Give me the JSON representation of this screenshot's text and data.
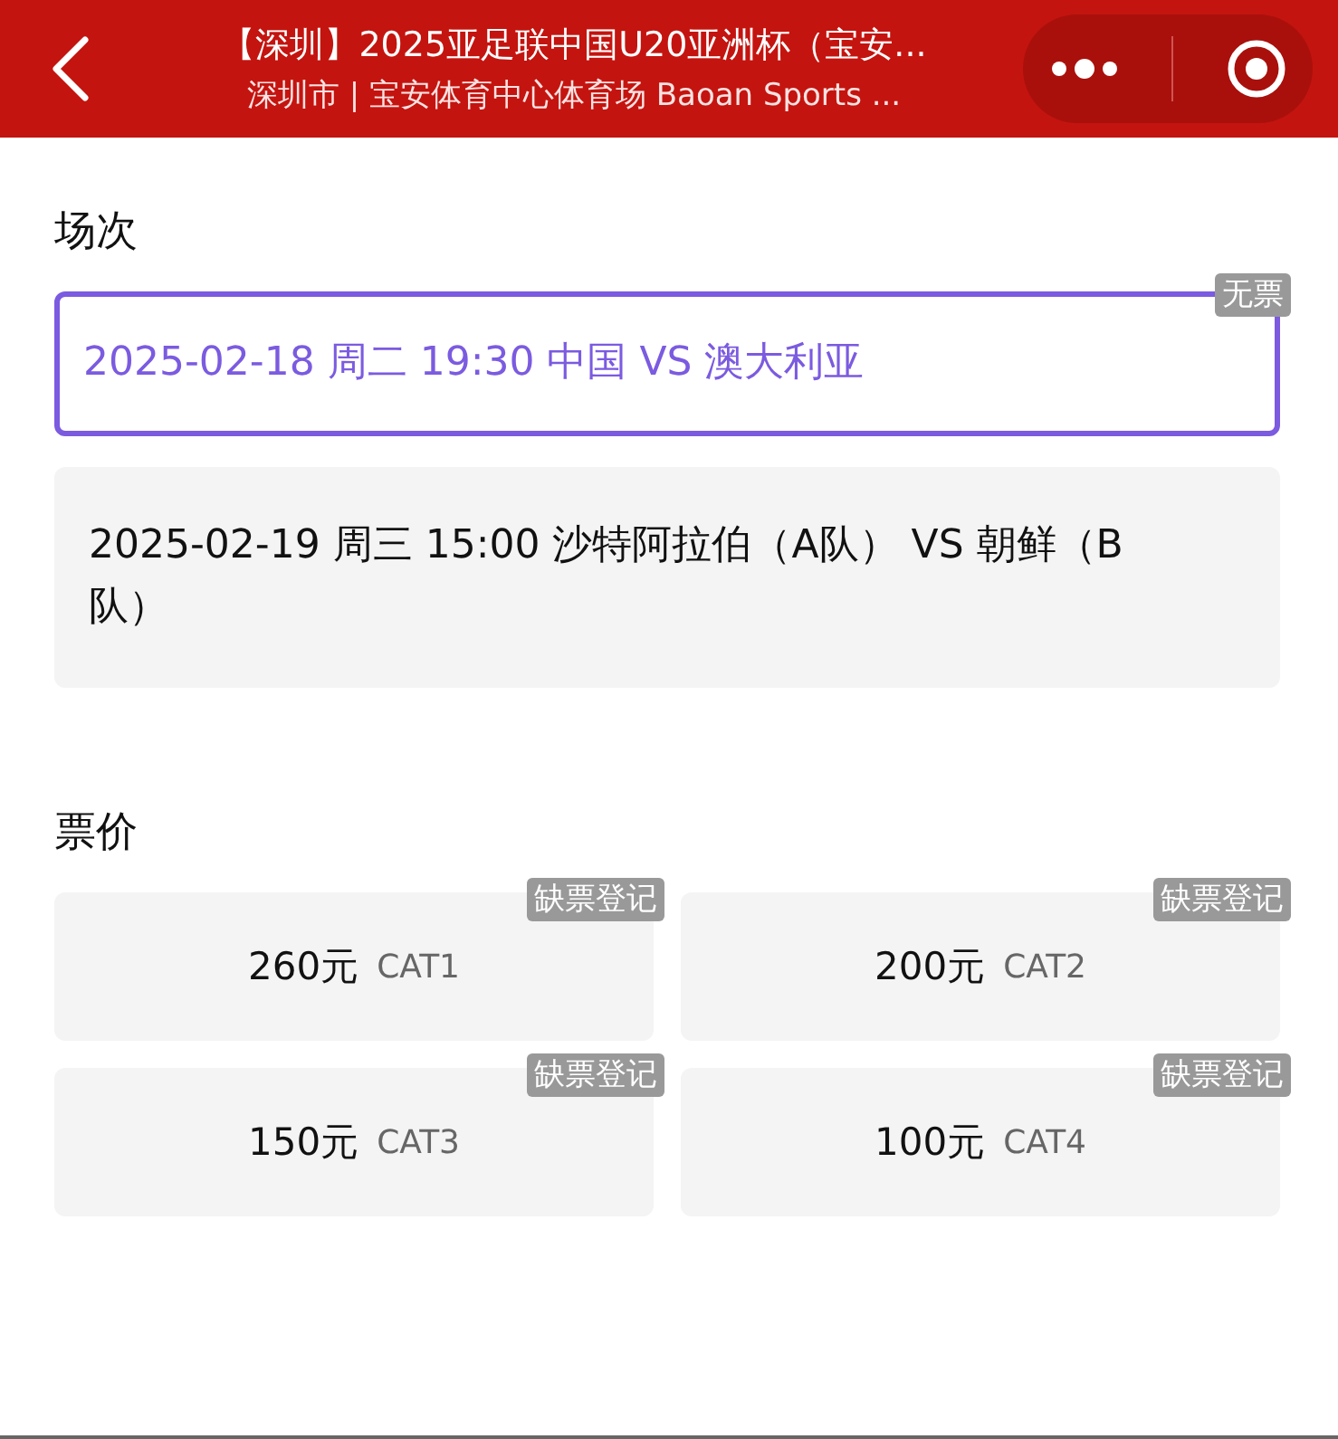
{
  "header": {
    "title": "【深圳】2025亚足联中国U20亚洲杯（宝安...",
    "subtitle": "深圳市 | 宝安体育中心体育场 Baoan Sports ..."
  },
  "sessions_section": {
    "heading": "场次",
    "sessions": [
      {
        "text": "2025-02-18 周二 19:30 中国 VS 澳大利亚",
        "selected": true,
        "badge": "无票"
      },
      {
        "text": "2025-02-19 周三 15:00 沙特阿拉伯（A队） VS 朝鲜（B队）",
        "selected": false
      }
    ]
  },
  "prices_section": {
    "heading": "票价",
    "prices": [
      {
        "price": "260元",
        "category": "CAT1",
        "badge": "缺票登记"
      },
      {
        "price": "200元",
        "category": "CAT2",
        "badge": "缺票登记"
      },
      {
        "price": "150元",
        "category": "CAT3",
        "badge": "缺票登记"
      },
      {
        "price": "100元",
        "category": "CAT4",
        "badge": "缺票登记"
      }
    ]
  }
}
